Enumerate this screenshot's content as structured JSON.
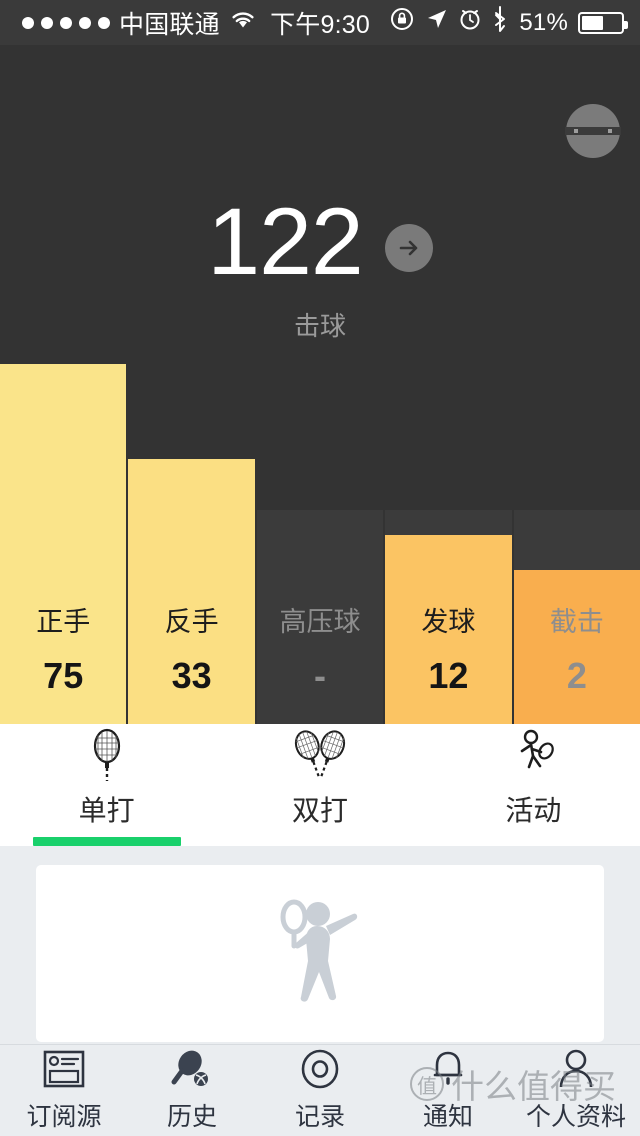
{
  "statusbar": {
    "carrier": "中国联通",
    "time": "下午9:30",
    "battery_pct": "51%",
    "battery_level": 51,
    "signal_dots": 5,
    "icons": [
      "wifi-icon",
      "rotation-lock-icon",
      "location-arrow-icon",
      "alarm-clock-icon",
      "bluetooth-icon",
      "battery-icon"
    ]
  },
  "hero": {
    "total_value": "122",
    "total_label": "击球",
    "detail_arrow": "arrow-right-icon",
    "device_badge": "sensor-device-icon",
    "background_color": "#333333"
  },
  "chart_data": {
    "type": "bar",
    "title": "击球",
    "categories": [
      "正手",
      "反手",
      "高压球",
      "发球",
      "截击"
    ],
    "values": [
      75,
      33,
      null,
      12,
      2
    ],
    "value_labels": [
      "75",
      "33",
      "-",
      "12",
      "2"
    ],
    "bar_colors": [
      "#fae48a",
      "#fbdf83",
      "#3b3b3b",
      "#fbc463",
      "#f9ae4e"
    ],
    "empty_track_color": "#3b3b3b",
    "filled": [
      true,
      true,
      false,
      true,
      false
    ],
    "xlabel": "",
    "ylabel": "",
    "ylim": [
      0,
      80
    ],
    "grid": false,
    "legend": "none"
  },
  "tabs": {
    "items": [
      {
        "label": "单打",
        "icon": "single-racket-icon",
        "active": true
      },
      {
        "label": "双打",
        "icon": "double-racket-icon",
        "active": false
      },
      {
        "label": "活动",
        "icon": "player-activity-icon",
        "active": false
      }
    ],
    "active_color": "#19d06b"
  },
  "content": {
    "placeholder_icon": "tennis-player-placeholder-icon"
  },
  "bottomnav": {
    "items": [
      {
        "label": "订阅源",
        "icon": "feed-icon",
        "active": false
      },
      {
        "label": "历史",
        "icon": "racket-ball-icon",
        "active": true
      },
      {
        "label": "记录",
        "icon": "record-circle-icon",
        "active": false
      },
      {
        "label": "通知",
        "icon": "bell-icon",
        "active": false
      },
      {
        "label": "个人资料",
        "icon": "person-icon",
        "active": false
      }
    ]
  },
  "watermark": {
    "mark": "值",
    "text": "什么值得买"
  }
}
